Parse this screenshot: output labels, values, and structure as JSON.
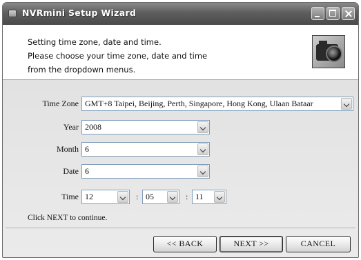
{
  "window": {
    "title": "NVRmini Setup Wizard"
  },
  "header": {
    "line1": "Setting time zone, date and time.",
    "line2": "Please choose your time zone, date and time",
    "line3": "from the dropdown menus.",
    "icon": "camera-icon"
  },
  "form": {
    "time_zone": {
      "label": "Time Zone",
      "value": "GMT+8 Taipei, Beijing, Perth, Singapore, Hong Kong, Ulaan Bataar"
    },
    "year": {
      "label": "Year",
      "value": "2008"
    },
    "month": {
      "label": "Month",
      "value": "6"
    },
    "date": {
      "label": "Date",
      "value": "6"
    },
    "time": {
      "label": "Time",
      "hour": "12",
      "minute": "05",
      "second": "11",
      "separator": ":"
    }
  },
  "hint": "Click NEXT to continue.",
  "buttons": {
    "back": "<< BACK",
    "next": "NEXT >>",
    "cancel": "CANCEL"
  }
}
